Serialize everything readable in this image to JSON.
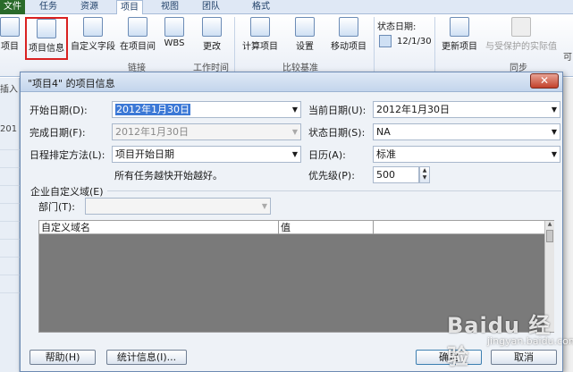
{
  "ribbon": {
    "tabs": [
      "文件",
      "任务",
      "资源",
      "项目",
      "视图",
      "团队",
      "格式"
    ],
    "buttons": {
      "subproject": "项目",
      "project_info": "项目信息",
      "custom_fields": "自定义字段",
      "links_between": "在项目间",
      "wbs": "WBS",
      "change_working_time": "更改",
      "calculate_project": "计算项目",
      "set_baseline": "设置",
      "move_project": "移动项目",
      "update_project": "更新项目",
      "sync_protected": "与受保护的实际值"
    },
    "group_labels": {
      "links": "链接",
      "working_time": "工作时间",
      "baseline": "比较基准",
      "sync": "同步"
    },
    "status_date_label": "状态日期:",
    "status_date_value": "12/1/30"
  },
  "sheet": {
    "left_labels": [
      "插入",
      "201"
    ],
    "right_label": "可"
  },
  "dialog": {
    "title": "\"项目4\" 的项目信息",
    "close": "✕",
    "fields": {
      "start_date_label": "开始日期(D):",
      "start_date_value": "2012年1月30日",
      "current_date_label": "当前日期(U):",
      "current_date_value": "2012年1月30日",
      "finish_date_label": "完成日期(F):",
      "finish_date_value": "2012年1月30日",
      "status_date_label": "状态日期(S):",
      "status_date_value": "NA",
      "schedule_from_label": "日程排定方法(L):",
      "schedule_from_value": "项目开始日期",
      "calendar_label": "日历(A):",
      "calendar_value": "标准",
      "schedule_note": "所有任务越快开始越好。",
      "priority_label": "优先级(P):",
      "priority_value": "500"
    },
    "enterprise": {
      "group_title": "企业自定义域(E)",
      "department_label": "部门(T):",
      "department_value": "",
      "columns": [
        "自定义域名",
        "值"
      ]
    },
    "buttons": {
      "help": "帮助(H)",
      "statistics": "统计信息(I)...",
      "ok": "确定",
      "cancel": "取消"
    }
  },
  "watermark": {
    "main": "Baidu 经验",
    "sub": "jingyan.baidu.com"
  }
}
